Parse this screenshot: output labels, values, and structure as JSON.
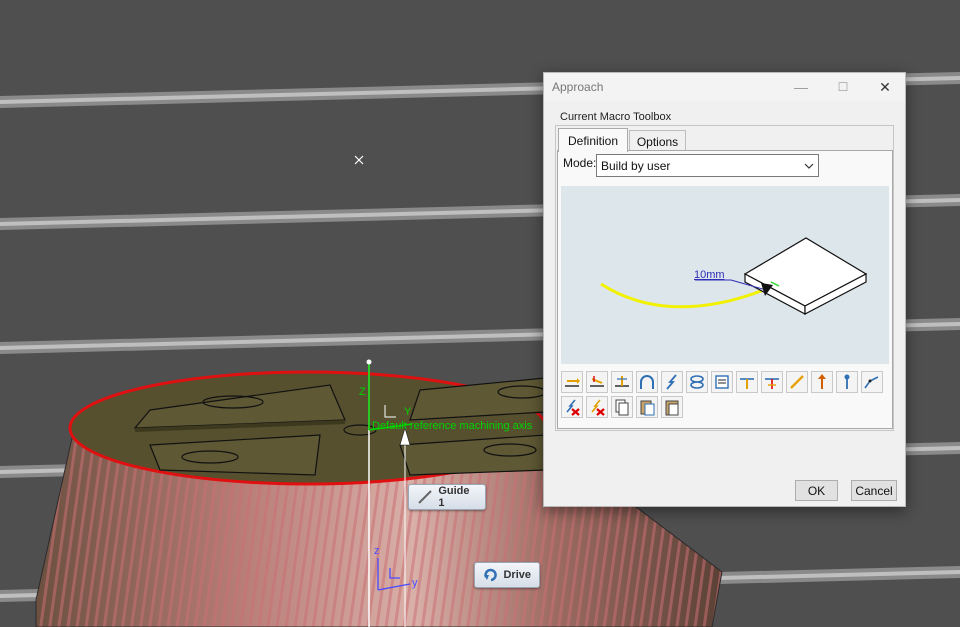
{
  "viewport": {
    "background": "#4f4f4f",
    "labels": {
      "guide": "Guide 1",
      "drive": "Drive",
      "axis_text": "Default reference machining axis",
      "axis_z": "Z",
      "axis_y": "Y",
      "small_z": "z",
      "small_y": "y"
    },
    "icons": [
      "cursor-x-icon",
      "guide-curve-icon",
      "drive-rotate-icon",
      "axis-triad-icon"
    ]
  },
  "dialog": {
    "title": "Approach",
    "window_buttons": {
      "minimize": "—",
      "maximize": "☐",
      "close": "✕"
    },
    "group_label": "Current Macro Toolbox",
    "tabs": [
      {
        "label": "Definition",
        "active": true
      },
      {
        "label": "Options",
        "active": false
      }
    ],
    "mode_label": "Mode:",
    "mode_value": "Build by user",
    "preview": {
      "dimension": "10mm"
    },
    "toolbar_row1": [
      "tangent-motion-icon",
      "normal-motion-icon",
      "axial-motion-icon",
      "circular-motion-icon",
      "ramping-motion-icon",
      "helix-motion-icon",
      "text-motion-icon",
      "plane-normal-icon",
      "plane-axis-icon",
      "line-motion-icon",
      "up-axis-icon",
      "point-axis-icon",
      "polyline-icon"
    ],
    "toolbar_row2": [
      "remove-motion-icon",
      "remove-all-icon",
      "copy-icon",
      "paste-icon",
      "clipboard-icon"
    ],
    "ok_label": "OK",
    "cancel_label": "Cancel"
  }
}
